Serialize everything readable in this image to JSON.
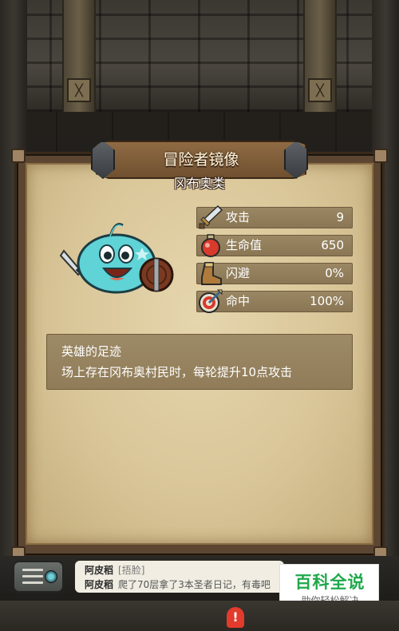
{
  "panel": {
    "title": "冒险者镜像",
    "subtitle": "冈布奥类"
  },
  "stats": [
    {
      "icon": "sword-icon",
      "label": "攻击",
      "value": "9"
    },
    {
      "icon": "potion-icon",
      "label": "生命值",
      "value": "650"
    },
    {
      "icon": "boot-icon",
      "label": "闪避",
      "value": "0%"
    },
    {
      "icon": "target-icon",
      "label": "命中",
      "value": "100%"
    }
  ],
  "ability": {
    "name": "英雄的足迹",
    "description": "场上存在冈布奥村民时，每轮提升10点攻击"
  },
  "chat": {
    "messages": [
      {
        "user": "阿皮稻",
        "tag": "[捂脸]",
        "text": ""
      },
      {
        "user": "阿皮稻",
        "tag": "",
        "text": "爬了70层拿了3本圣者日记，有毒吧"
      }
    ]
  },
  "watermark": {
    "title": "百科全说",
    "subtitle": "助你轻松解决"
  },
  "alert": {
    "symbol": "!"
  },
  "colors": {
    "parchment": "#d9c698",
    "stat_bar": "#8a7654",
    "slime": "#5fd3d6",
    "watermark_green": "#1fa84a",
    "alert_red": "#e23b2c"
  }
}
